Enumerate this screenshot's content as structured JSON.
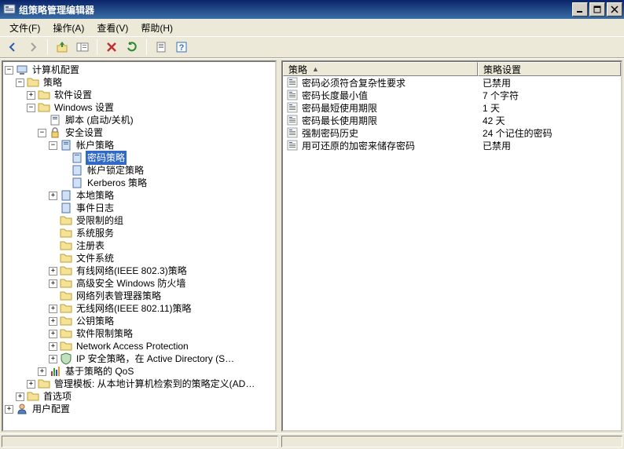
{
  "window": {
    "title": "组策略管理编辑器"
  },
  "menu": {
    "file": "文件(F)",
    "action": "操作(A)",
    "view": "查看(V)",
    "help": "帮助(H)"
  },
  "tree_root": "计算机配置",
  "tree_policies": "策略",
  "tree_software_settings": "软件设置",
  "tree_windows_settings": "Windows 设置",
  "tree_scripts": "脚本 (启动/关机)",
  "tree_security": "安全设置",
  "tree_account_policies": "帐户策略",
  "tree_password_policy": "密码策略",
  "tree_lockout_policy": "帐户锁定策略",
  "tree_kerberos": "Kerberos 策略",
  "tree_local_policies": "本地策略",
  "tree_event_log": "事件日志",
  "tree_restricted_groups": "受限制的组",
  "tree_system_services": "系统服务",
  "tree_registry": "注册表",
  "tree_file_system": "文件系统",
  "tree_wired": "有线网络(IEEE 802.3)策略",
  "tree_firewall": "高级安全 Windows 防火墙",
  "tree_nlm": "网络列表管理器策略",
  "tree_wireless": "无线网络(IEEE 802.11)策略",
  "tree_pki": "公钥策略",
  "tree_srp": "软件限制策略",
  "tree_nap": "Network Access Protection",
  "tree_ipsec": "IP 安全策略，在 Active Directory (S…",
  "tree_qos": "基于策略的 QoS",
  "tree_adm": "管理模板: 从本地计算机检索到的策略定义(AD…",
  "tree_preferences": "首选项",
  "tree_user": "用户配置",
  "columns": {
    "policy": "策略",
    "setting": "策略设置"
  },
  "rows": [
    {
      "name": "密码必须符合复杂性要求",
      "value": "已禁用"
    },
    {
      "name": "密码长度最小值",
      "value": "7 个字符"
    },
    {
      "name": "密码最短使用期限",
      "value": "1 天"
    },
    {
      "name": "密码最长使用期限",
      "value": "42 天"
    },
    {
      "name": "强制密码历史",
      "value": "24 个记住的密码"
    },
    {
      "name": "用可还原的加密来储存密码",
      "value": "已禁用"
    }
  ]
}
